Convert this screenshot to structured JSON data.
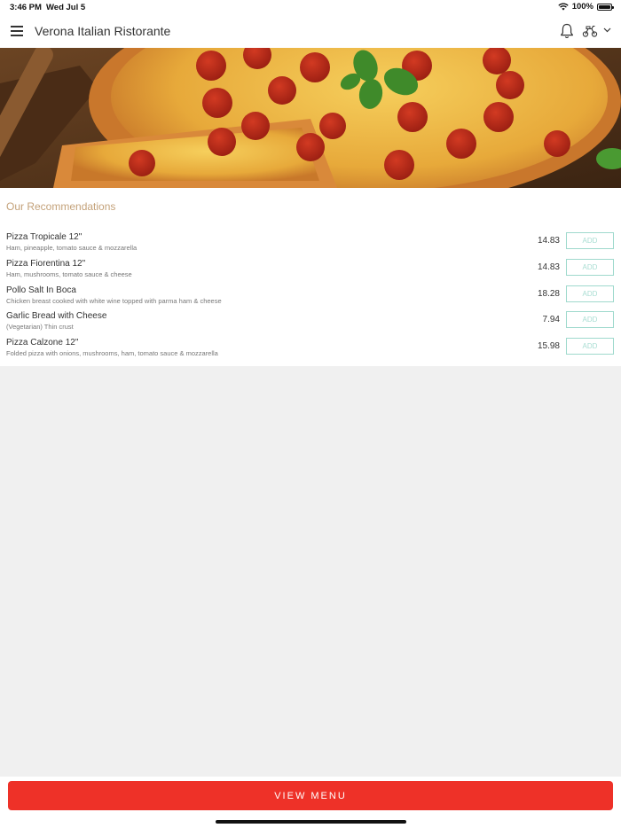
{
  "status_bar": {
    "time": "3:46 PM",
    "date": "Wed Jul 5",
    "battery_text": "100%",
    "battery_level": 1.0,
    "wifi_icon": "wifi-icon"
  },
  "header": {
    "title": "Verona Italian Ristorante",
    "menu_icon": "hamburger-menu-icon",
    "notification_icon": "bell-icon",
    "delivery_icon": "scooter-icon",
    "dropdown_icon": "chevron-down-icon"
  },
  "hero": {
    "image": "pepperoni-pizza-photo"
  },
  "recommendations": {
    "title": "Our Recommendations",
    "items": [
      {
        "name": "Pizza Tropicale 12\"",
        "description": "Ham, pineapple, tomato sauce & mozzarella",
        "price": "14.83",
        "add_label": "ADD"
      },
      {
        "name": "Pizza Fiorentina 12\"",
        "description": "Ham, mushrooms, tomato sauce & cheese",
        "price": "14.83",
        "add_label": "ADD"
      },
      {
        "name": "Pollo Salt In Boca",
        "description": "Chicken breast cooked with white wine topped with parma ham & cheese",
        "price": "18.28",
        "add_label": "ADD"
      },
      {
        "name": "Garlic Bread with Cheese",
        "description": "(Vegetarian) Thin crust",
        "price": "7.94",
        "add_label": "ADD"
      },
      {
        "name": "Pizza Calzone 12\"",
        "description": "Folded pizza with onions, mushrooms, ham, tomato sauce & mozzarella",
        "price": "15.98",
        "add_label": "ADD"
      }
    ]
  },
  "footer": {
    "view_menu_label": "VIEW MENU"
  },
  "colors": {
    "accent_red": "#ee3128",
    "section_title": "#c4a27a",
    "add_button_border": "#9fd9cd",
    "page_background": "#f0f0f0"
  }
}
